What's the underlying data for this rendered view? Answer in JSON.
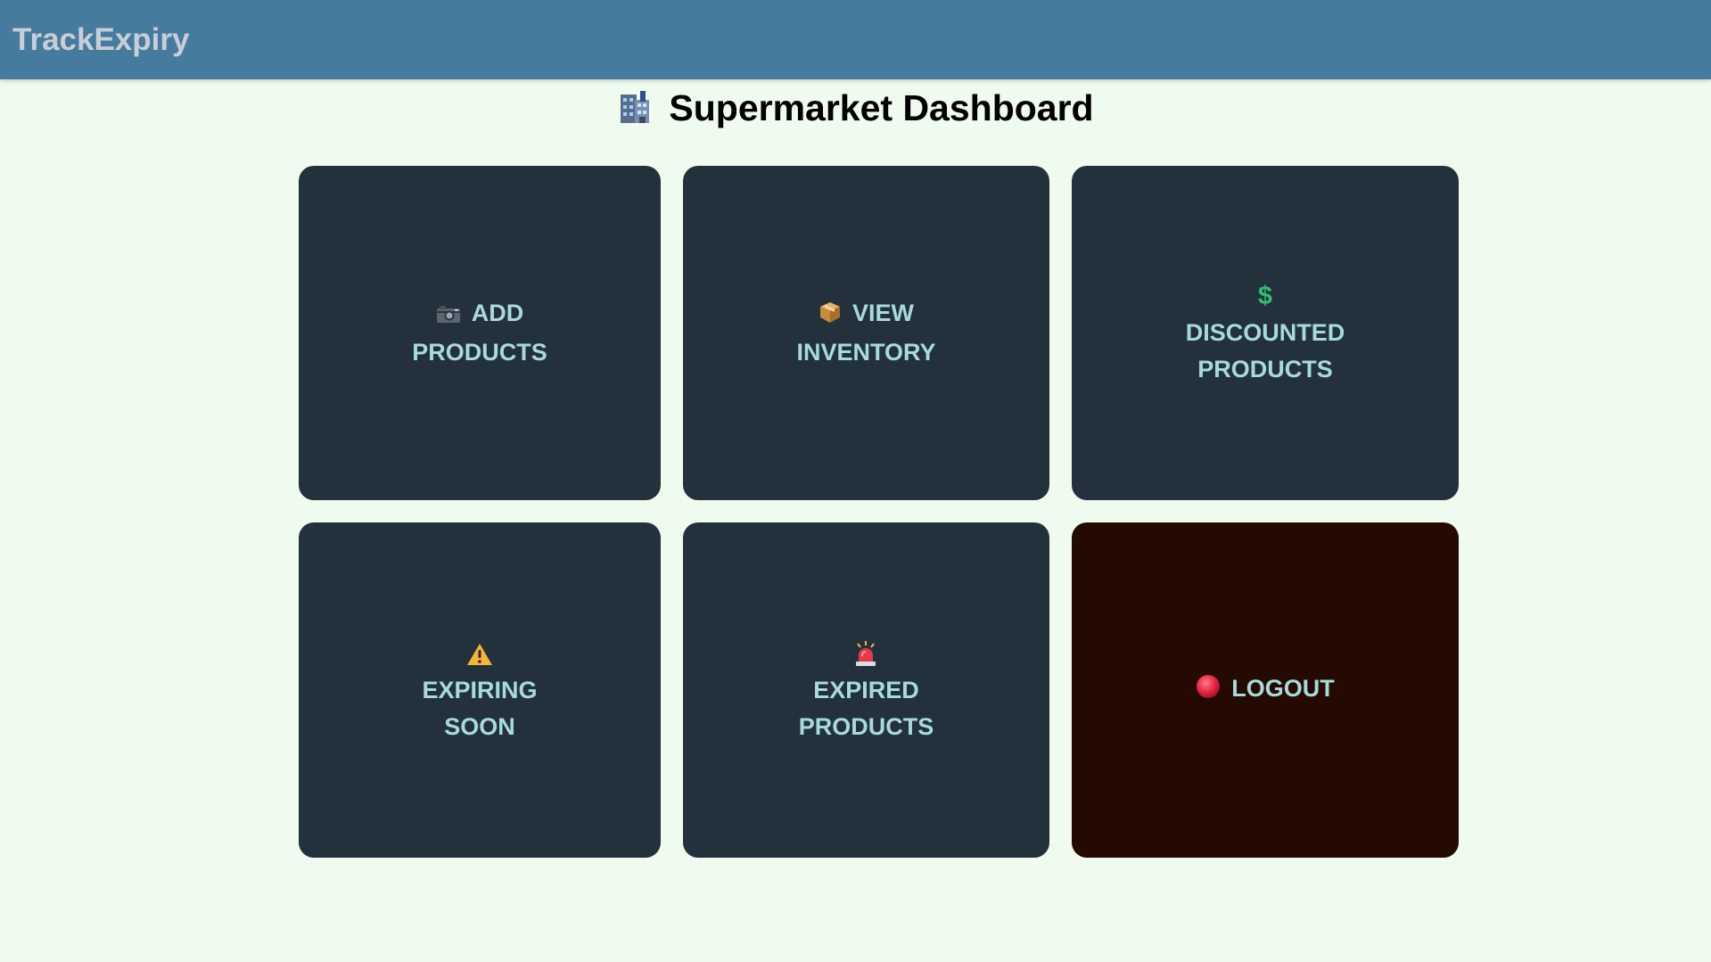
{
  "app": {
    "brand": "TrackExpiry"
  },
  "page": {
    "title": "Supermarket Dashboard",
    "title_icon": "office-building-icon"
  },
  "cards": [
    {
      "icon": "camera-icon",
      "line1": "ADD",
      "line2": "PRODUCTS"
    },
    {
      "icon": "package-icon",
      "line1": "VIEW",
      "line2": "INVENTORY"
    },
    {
      "icon": "dollar-icon",
      "icon_text": "$",
      "line1": "DISCOUNTED",
      "line2": "PRODUCTS"
    },
    {
      "icon": "warning-icon",
      "line1": "EXPIRING",
      "line2": "SOON"
    },
    {
      "icon": "siren-icon",
      "line1": "EXPIRED",
      "line2": "PRODUCTS"
    },
    {
      "icon": "red-circle-icon",
      "line1": "LOGOUT"
    }
  ],
  "colors": {
    "navbar": "#457b9d",
    "background": "#f0fbef",
    "card": "#22313b",
    "logout_card": "#250a02",
    "card_text": "#a8dadc"
  }
}
